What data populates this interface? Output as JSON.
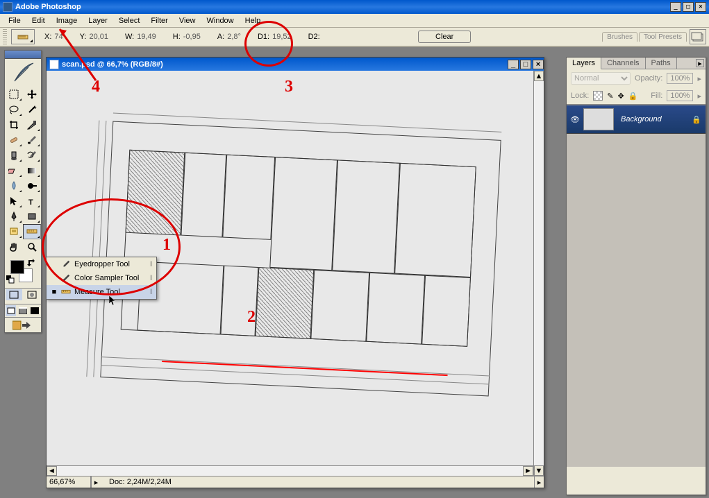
{
  "app": {
    "title": "Adobe Photoshop"
  },
  "menu": {
    "items": [
      "File",
      "Edit",
      "Image",
      "Layer",
      "Select",
      "Filter",
      "View",
      "Window",
      "Help"
    ]
  },
  "options": {
    "x_label": "X:",
    "x_val": "74",
    "y_label": "Y:",
    "y_val": "20,01",
    "w_label": "W:",
    "w_val": "19,49",
    "h_label": "H:",
    "h_val": "-0,95",
    "a_label": "A:",
    "a_val": "2,8°",
    "d1_label": "D1:",
    "d1_val": "19,52",
    "d2_label": "D2:",
    "d2_val": "",
    "clear": "Clear",
    "tab_brushes": "Brushes",
    "tab_toolpresets": "Tool Presets"
  },
  "flyout": {
    "items": [
      {
        "sel": "",
        "label": "Eyedropper Tool",
        "shortcut": "I"
      },
      {
        "sel": "",
        "label": "Color Sampler Tool",
        "shortcut": "I"
      },
      {
        "sel": "■",
        "label": "Measure Tool",
        "shortcut": "I"
      }
    ]
  },
  "doc": {
    "title": "scan.psd @ 66,7% (RGB/8#)",
    "zoom": "66,67%",
    "info_prefix": "Doc:",
    "info": "2,24M/2,24M"
  },
  "layers_panel": {
    "tab_layers": "Layers",
    "tab_channels": "Channels",
    "tab_paths": "Paths",
    "blend": "Normal",
    "opacity_label": "Opacity:",
    "opacity_val": "100%",
    "lock_label": "Lock:",
    "fill_label": "Fill:",
    "fill_val": "100%",
    "layer_name": "Background"
  },
  "annotations": {
    "n1": "1",
    "n2": "2",
    "n3": "3",
    "n4": "4"
  }
}
